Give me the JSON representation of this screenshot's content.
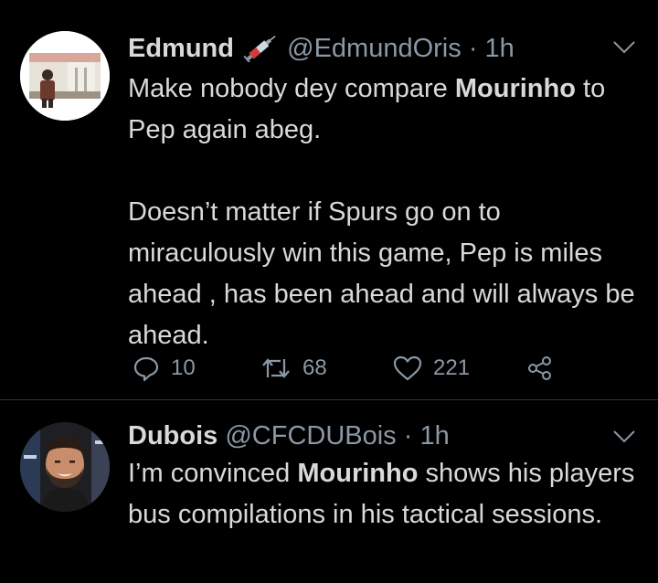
{
  "tweets": [
    {
      "display_name": "Edmund",
      "badge_icon": "syringe-emoji",
      "handle": "@EdmundOris",
      "separator": "·",
      "time": "1h",
      "lines": {
        "p1_pre": "Make nobody dey compare ",
        "p1_bold": "Mourinho",
        "p1_post": " to Pep again abeg.",
        "p2": "Doesn’t matter if Spurs go on to miraculously win this game, Pep is miles ahead , has been ahead and will always be ahead."
      },
      "actions": {
        "replies": "10",
        "retweets": "68",
        "likes": "221"
      }
    },
    {
      "display_name": "Dubois",
      "handle": "@CFCDUBois",
      "separator": "·",
      "time": "1h",
      "lines": {
        "p1_pre": "I’m convinced ",
        "p1_bold": "Mourinho",
        "p1_post": " shows his players bus compilations in his tactical sessions."
      }
    }
  ],
  "colors": {
    "background": "#000000",
    "text": "#d9d9d9",
    "secondary": "#8b98a5",
    "divider": "#2f3336"
  },
  "icons": [
    "chevron-down-icon",
    "reply-icon",
    "retweet-icon",
    "like-icon",
    "share-icon"
  ]
}
